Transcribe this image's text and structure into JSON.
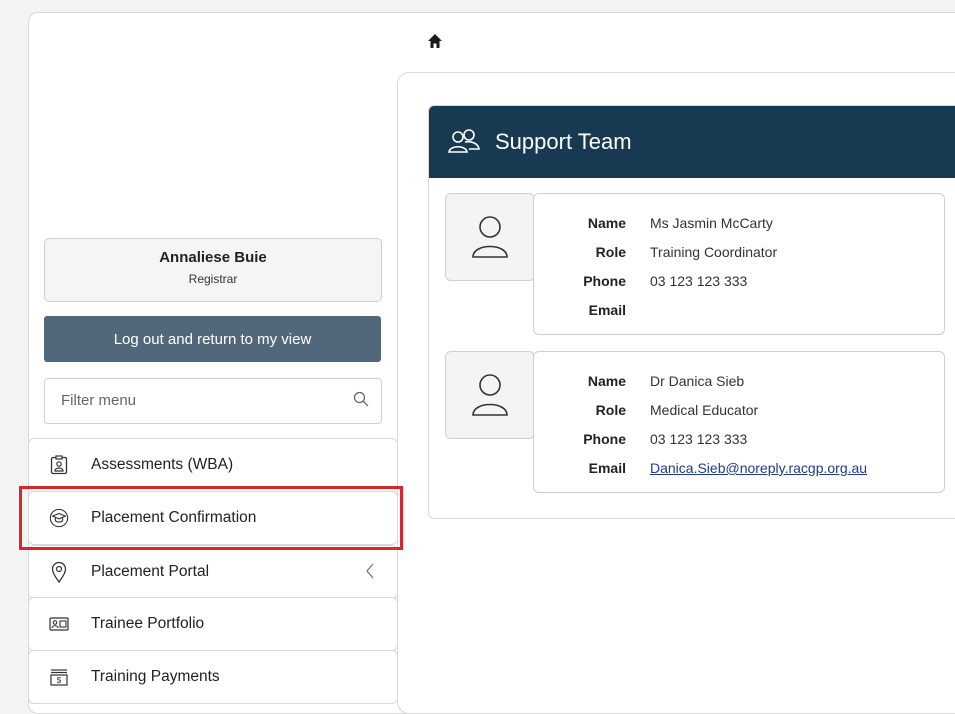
{
  "profile": {
    "name": "Annaliese Buie",
    "role": "Registrar"
  },
  "logout_label": "Log out and return to my view",
  "filter": {
    "placeholder": "Filter menu"
  },
  "menu": [
    {
      "label": "Assessments (WBA)",
      "icon": "clipboard-user-icon"
    },
    {
      "label": "Placement Confirmation",
      "icon": "graduation-cap-icon",
      "highlighted": true
    },
    {
      "label": "Placement Portal",
      "icon": "location-pin-icon"
    },
    {
      "label": "Trainee Portfolio",
      "icon": "id-card-icon"
    },
    {
      "label": "Training Payments",
      "icon": "money-stack-icon"
    }
  ],
  "card": {
    "title": "Support Team",
    "members": [
      {
        "labels": {
          "name": "Name",
          "role": "Role",
          "phone": "Phone",
          "email": "Email"
        },
        "name": "Ms Jasmin McCarty",
        "role": "Training Coordinator",
        "phone": "03 123 123 333",
        "email": ""
      },
      {
        "labels": {
          "name": "Name",
          "role": "Role",
          "phone": "Phone",
          "email": "Email"
        },
        "name": "Dr Danica Sieb",
        "role": "Medical Educator",
        "phone": "03 123 123 333",
        "email": "Danica.Sieb@noreply.racgp.org.au"
      }
    ]
  },
  "colors": {
    "header_bg": "#173a52",
    "button_bg": "#52687a",
    "highlight": "#d9252b",
    "link": "#1f3a93"
  }
}
